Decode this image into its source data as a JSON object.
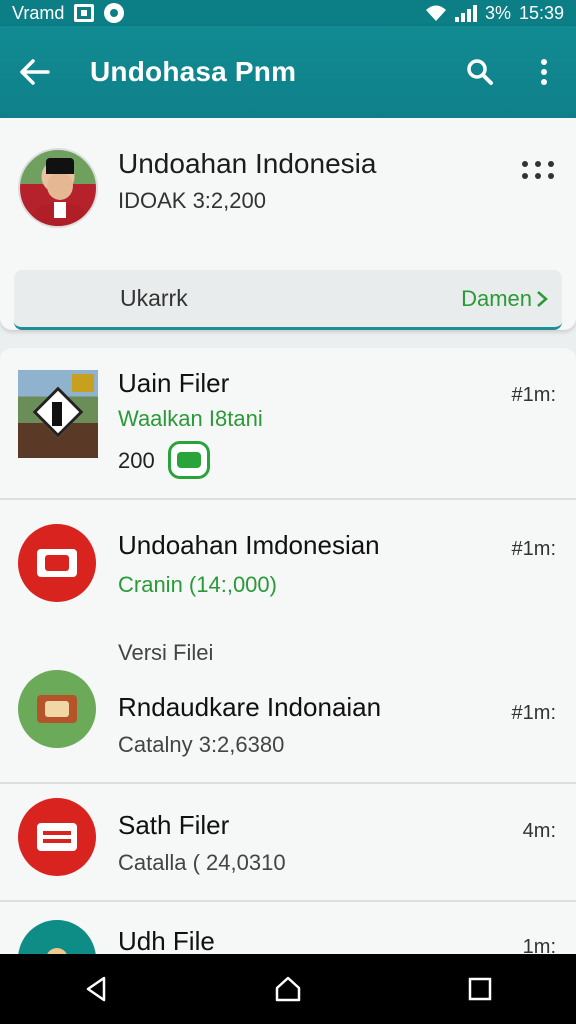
{
  "status_bar": {
    "carrier": "Vramd",
    "battery": "3%",
    "time": "15:39"
  },
  "app_bar": {
    "title": "Undohasa Pnm",
    "color": "#0f8089"
  },
  "profile": {
    "name": "Undoahan Indonesia",
    "subtitle": "IDOAK 3:2,200",
    "filter_label": "Ukarrk",
    "filter_action": "Damen"
  },
  "items": [
    {
      "title": "Uain Filer",
      "subtitle": "Waalkan I8tani",
      "count": "200",
      "time": "#1m:"
    },
    {
      "title": "Undoahan Imdonesian",
      "subtitle": "Cranin (14:,000)",
      "time": "#1m:",
      "icon_color": "#d9231e"
    },
    {
      "section_label": "Versi Filei",
      "title": "Rndaudkare Indonaian",
      "subtitle": "Catalny 3:2,6380",
      "time": "#1m:",
      "icon_color": "#6aaa58"
    },
    {
      "title": "Sath Filer",
      "subtitle": "Catalla ( 24,0310",
      "time": "4m:",
      "icon_color": "#d9231e"
    },
    {
      "title": "Udh File",
      "time": "1m:",
      "icon_color": "#0e8c86"
    }
  ],
  "icons": {
    "back": "arrow-left",
    "search": "magnifier",
    "more": "vertical-dots",
    "nav": [
      "back-triangle",
      "home-house",
      "recents-square"
    ]
  }
}
